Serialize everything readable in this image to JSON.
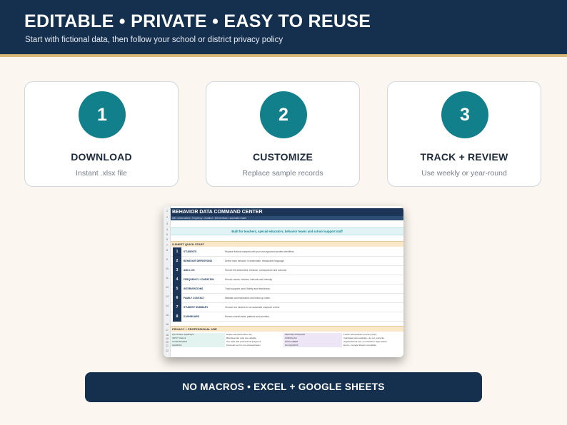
{
  "header": {
    "title": "EDITABLE • PRIVATE • EASY TO REUSE",
    "subtitle": "Start with fictional data, then follow your school or district privacy policy"
  },
  "steps": [
    {
      "number": "1",
      "title": "DOWNLOAD",
      "description": "Instant .xlsx file"
    },
    {
      "number": "2",
      "title": "CUSTOMIZE",
      "description": "Replace sample records"
    },
    {
      "number": "3",
      "title": "TRACK + REVIEW",
      "description": "Use weekly or year-round"
    }
  ],
  "sheet": {
    "title": "BEHAVIOR DATA COMMAND CENTER",
    "subtitle": "ABC observations • frequency • duration • interventions • automatic charts",
    "banner": "Built for teachers, special educators, behavior teams and school support staff",
    "quickstart_header": "9-SHEET QUICK START",
    "quickstart": [
      {
        "num": "1",
        "name": "STUDENTS",
        "desc": "Replace fictional samples with your own approved student identifiers."
      },
      {
        "num": "2",
        "name": "BEHAVIOR DEFINITIONS",
        "desc": "Define each behavior in observable, measurable language."
      },
      {
        "num": "3",
        "name": "ABC LOG",
        "desc": "Record the antecedent, behavior, consequence and outcome."
      },
      {
        "num": "4",
        "name": "FREQUENCY + DURATION",
        "desc": "Record counts, minutes, intervals and intensity."
      },
      {
        "num": "5",
        "name": "INTERVENTIONS",
        "desc": "Track supports used, fidelity and helpfulness."
      },
      {
        "num": "6",
        "name": "FAMILY CONTACT",
        "desc": "Maintain communication and follow-up notes."
      },
      {
        "num": "7",
        "name": "STUDENT SUMMARY",
        "desc": "Choose one student for an automatic snapshot review."
      },
      {
        "num": "8",
        "name": "DASHBOARD",
        "desc": "Review overall totals, patterns and priorities."
      }
    ],
    "privacy_header": "PRIVACY + PROFESSIONAL USE",
    "privacy_rows": [
      [
        "FICTIONAL SAMPLES",
        "Delete samples before use",
        "SECURE STORAGE",
        "Follow school/district privacy policy"
      ],
      [
        "INPUT CELLS",
        "Blue/lavender cells are editable",
        "FORMULAS",
        "Calculated automatically—do not overwrite"
      ],
      [
        "TEAM REVIEW",
        "Use data with professional judgment",
        "DISCLAIMER",
        "Organizational tool, not clinical or legal advice"
      ],
      [
        "SHARING",
        "Personal use for one educator/team",
        "NO MACROS",
        "Excel + Google Sheets compatible"
      ]
    ],
    "row_numbers": [
      "1",
      "2",
      "3",
      "4",
      "5",
      "6",
      "7",
      "8",
      "9",
      "10",
      "11",
      "12",
      "13",
      "14",
      "15",
      "16",
      "17",
      "18",
      "19",
      "20",
      "21",
      "22"
    ]
  },
  "footer": {
    "label": "NO MACROS • EXCEL + GOOGLE SHEETS"
  },
  "colors": {
    "navy": "#15304f",
    "teal": "#12808a",
    "gold_stripe": "#d8b878",
    "background": "#fbf6ef"
  }
}
